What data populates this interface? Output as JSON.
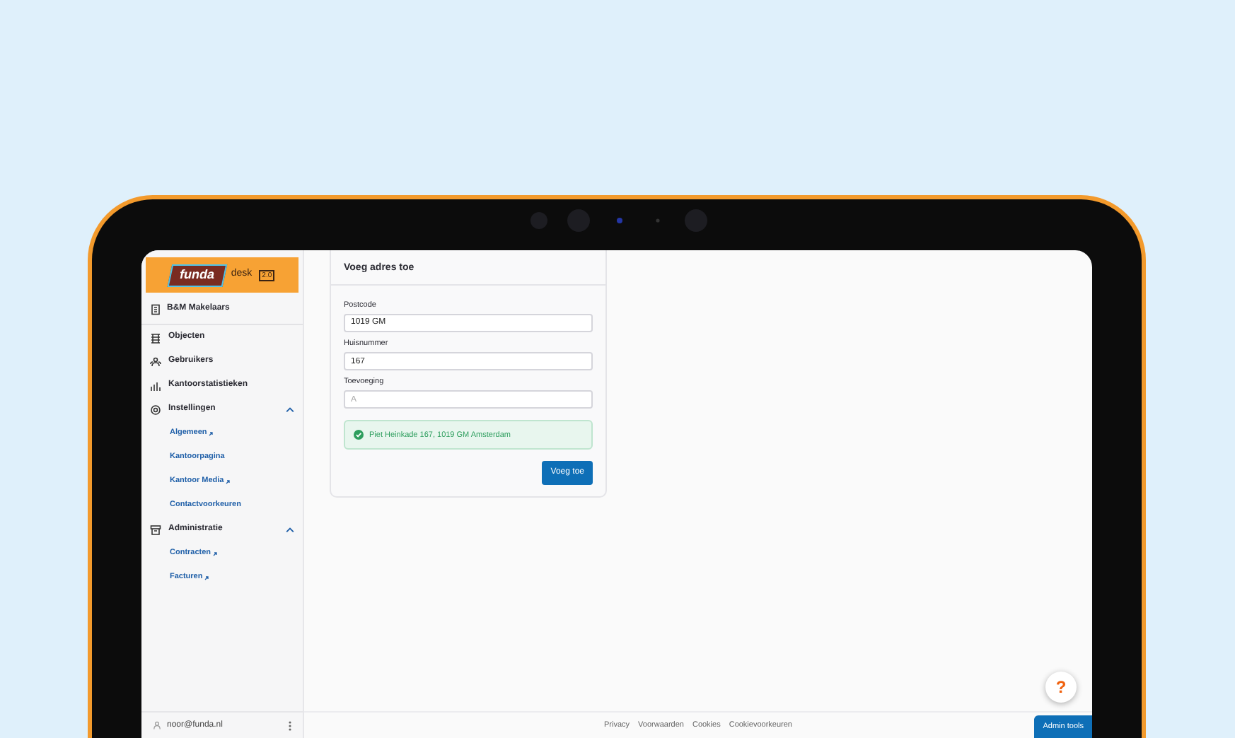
{
  "sidebar": {
    "logo": {
      "brand": "funda",
      "product": "desk",
      "version": "2.0"
    },
    "office": "B&M Makelaars",
    "items": [
      {
        "label": "Objecten",
        "kind": "link"
      },
      {
        "label": "Gebruikers",
        "kind": "link"
      },
      {
        "label": "Kantoorstatistieken",
        "kind": "link"
      },
      {
        "label": "Instellingen",
        "kind": "group",
        "expanded": true,
        "children": [
          {
            "label": "Algemeen",
            "external": true
          },
          {
            "label": "Kantoorpagina",
            "external": false
          },
          {
            "label": "Kantoor Media",
            "external": true
          },
          {
            "label": "Contactvoorkeuren",
            "external": false
          }
        ]
      },
      {
        "label": "Administratie",
        "kind": "group",
        "expanded": true,
        "children": [
          {
            "label": "Contracten",
            "external": true
          },
          {
            "label": "Facturen",
            "external": true
          }
        ]
      }
    ],
    "user": {
      "email": "noor@funda.nl"
    }
  },
  "form": {
    "title": "Voeg adres toe",
    "fields": [
      {
        "label": "Postcode",
        "value": "1019 GM"
      },
      {
        "label": "Huisnummer",
        "value": "167"
      },
      {
        "label": "Toevoeging",
        "placeholder": "A"
      }
    ],
    "alert": {
      "kind": "success",
      "text": "Piet Heinkade 167, 1019 GM Amsterdam"
    },
    "submit": "Voeg toe"
  },
  "footer": {
    "links": [
      "Privacy",
      "Voorwaarden",
      "Cookies",
      "Cookievoorkeuren"
    ]
  },
  "help_button": "?",
  "admin_button": "Admin tools"
}
